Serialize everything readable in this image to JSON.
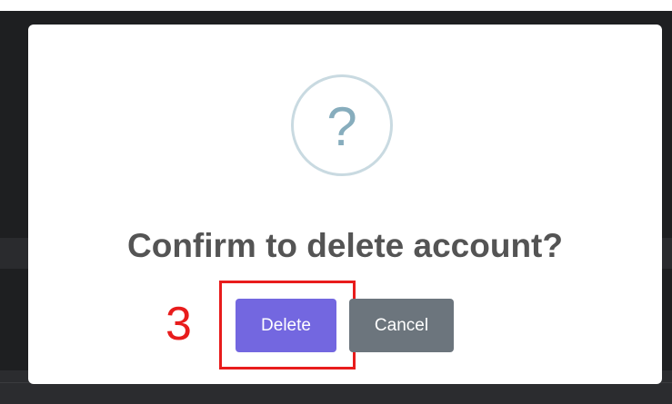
{
  "dialog": {
    "icon": "question-mark-icon",
    "icon_glyph": "?",
    "title": "Confirm to delete account?",
    "delete_label": "Delete",
    "cancel_label": "Cancel",
    "annotation_number": "3"
  },
  "colors": {
    "delete_button": "#7367e0",
    "cancel_button": "#6c757d",
    "annotation": "#e81c1c",
    "icon_ring": "#c9dae1",
    "icon_glyph": "#87adbd",
    "title": "#545454"
  }
}
